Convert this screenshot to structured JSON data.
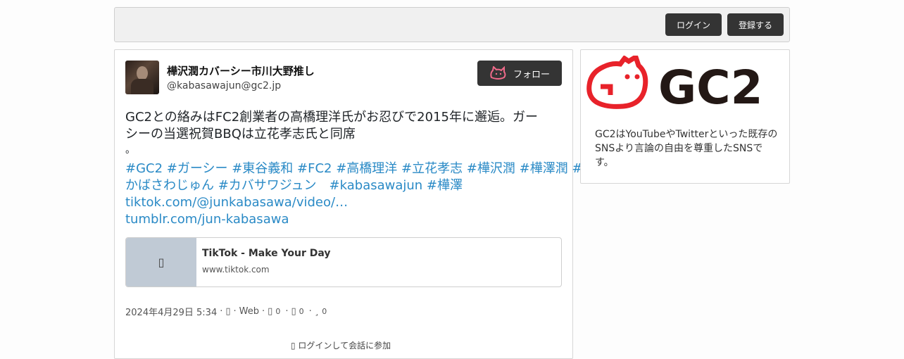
{
  "header": {
    "login_label": "ログイン",
    "register_label": "登録する"
  },
  "post": {
    "display_name": "樺沢潤カバーシー市川大野推し",
    "handle": "@kabasawajun@gc2.jp",
    "follow_label": "フォロー",
    "text_lines": [
      "GC2との絡みはFC2創業者の高橋理洋氏がお忍びで2015年に邂逅。ガー",
      "シーの当選祝賀BBQは立花孝志氏と同席",
      "。"
    ],
    "tag_lines": [
      "#GC2 #ガーシー #東谷義和 #FC2 #高橋理洋 #立花孝志 #樺沢潤 #樺澤潤 #",
      "かばさわじゅん #カバサワジュン　#kabasawajun #樺澤",
      "tiktok.com/@junkabasawa/video/…",
      "tumblr.com/jun-kabasawa"
    ],
    "card": {
      "title": "TikTok - Make Your Day",
      "domain": "www.tiktok.com",
      "thumb_icon": "file-icon"
    },
    "meta": {
      "date": "2024年4月29日 5:34",
      "sep": "·",
      "visibility_icon": "globe-icon",
      "client": "Web",
      "replies": "0",
      "boosts": "0",
      "favourites": "0"
    },
    "join_text": " ログインして会話に参加"
  },
  "sidebar": {
    "logo_text": "GC2",
    "description": "GC2はYouTubeやTwitterといった既存のSNSより言論の自由を尊重したSNSです。",
    "brand_red": "#e8222a",
    "brand_dark": "#231815"
  }
}
